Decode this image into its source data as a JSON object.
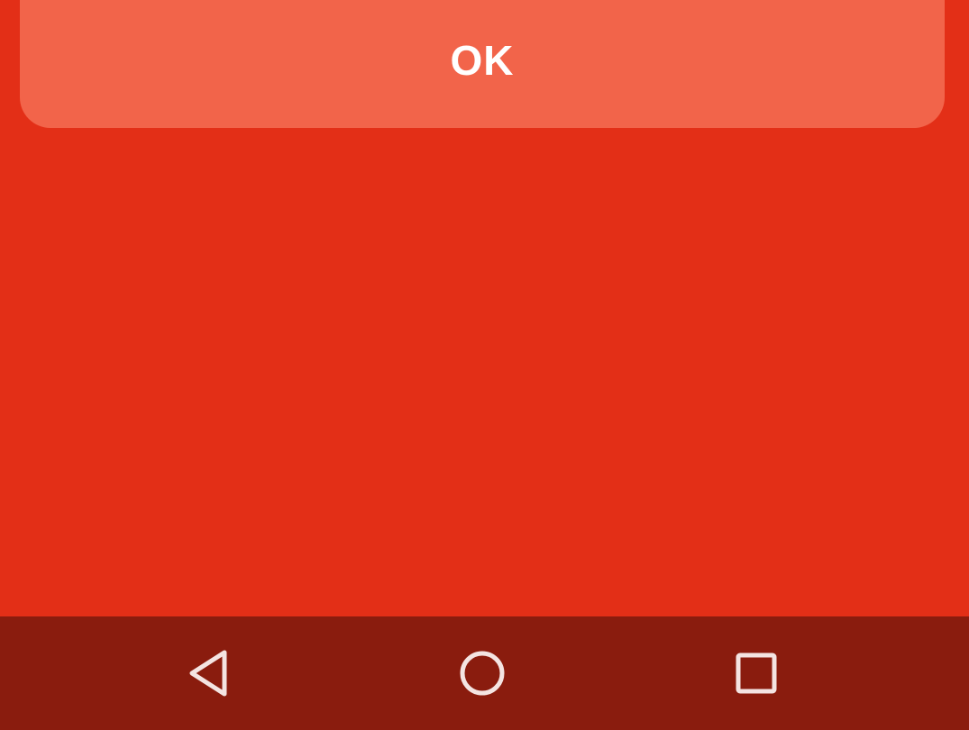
{
  "dialog": {
    "ok_label": "OK"
  },
  "navigation_bar": {
    "icons": {
      "back": "back-triangle-icon",
      "home": "home-circle-icon",
      "recents": "recents-square-icon"
    }
  },
  "colors": {
    "background": "#e32f17",
    "button": "#f2644a",
    "navigation_bar": "#8a1c0e",
    "nav_icon": "#f4e4e2",
    "text": "#ffffff"
  }
}
